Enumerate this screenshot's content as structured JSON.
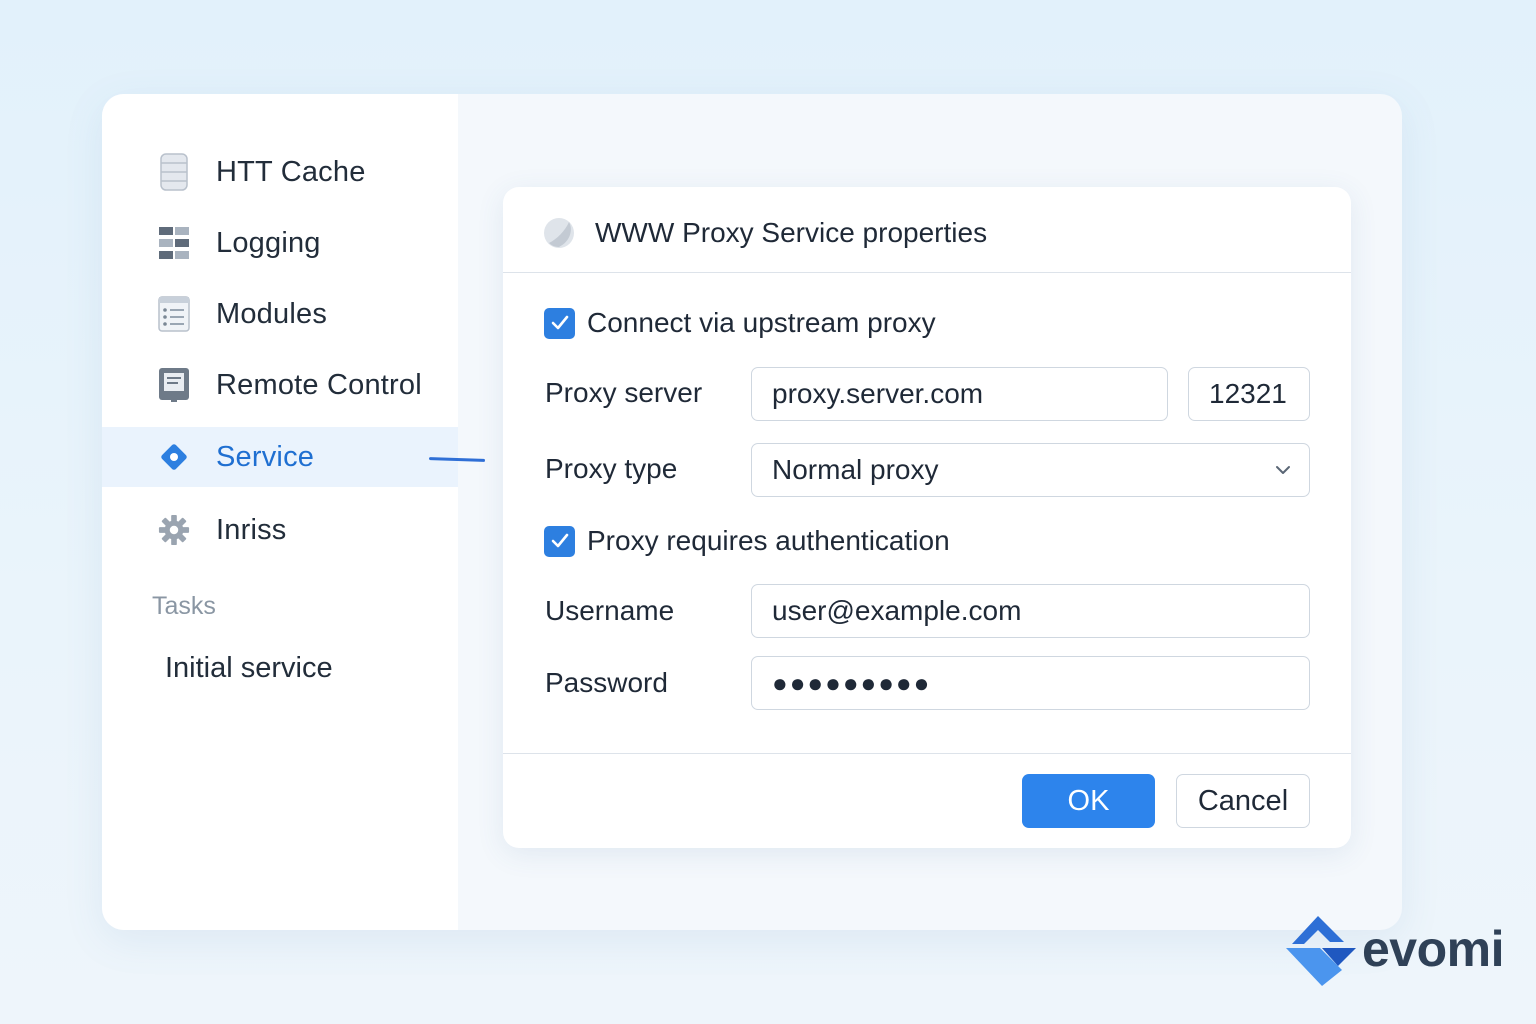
{
  "sidebar": {
    "items": [
      {
        "label": "HTT Cache",
        "icon": "database-icon"
      },
      {
        "label": "Logging",
        "icon": "log-table-icon"
      },
      {
        "label": "Modules",
        "icon": "list-icon"
      },
      {
        "label": "Remote Control",
        "icon": "remote-panel-icon"
      },
      {
        "label": "Service",
        "icon": "service-diamond-icon",
        "active": true
      },
      {
        "label": "Inriss",
        "icon": "gear-icon"
      }
    ],
    "tasks_heading": "Tasks",
    "tasks": [
      {
        "label": "Initial service"
      }
    ]
  },
  "dialog": {
    "title": "WWW Proxy Service properties",
    "connect_upstream": {
      "label": "Connect via upstream proxy",
      "checked": true
    },
    "proxy_server": {
      "label": "Proxy server",
      "host": "proxy.server.com",
      "port": "12321"
    },
    "proxy_type": {
      "label": "Proxy type",
      "value": "Normal proxy"
    },
    "requires_auth": {
      "label": "Proxy requires authentication",
      "checked": true
    },
    "username": {
      "label": "Username",
      "value": "user@example.com"
    },
    "password": {
      "label": "Password",
      "value": "●●●●●●●●●"
    },
    "ok_label": "OK",
    "cancel_label": "Cancel"
  },
  "brand": {
    "name": "evomi"
  },
  "colors": {
    "accent": "#2d84ec",
    "active_text": "#1f6fd1",
    "active_bg": "#eaf3fd"
  }
}
